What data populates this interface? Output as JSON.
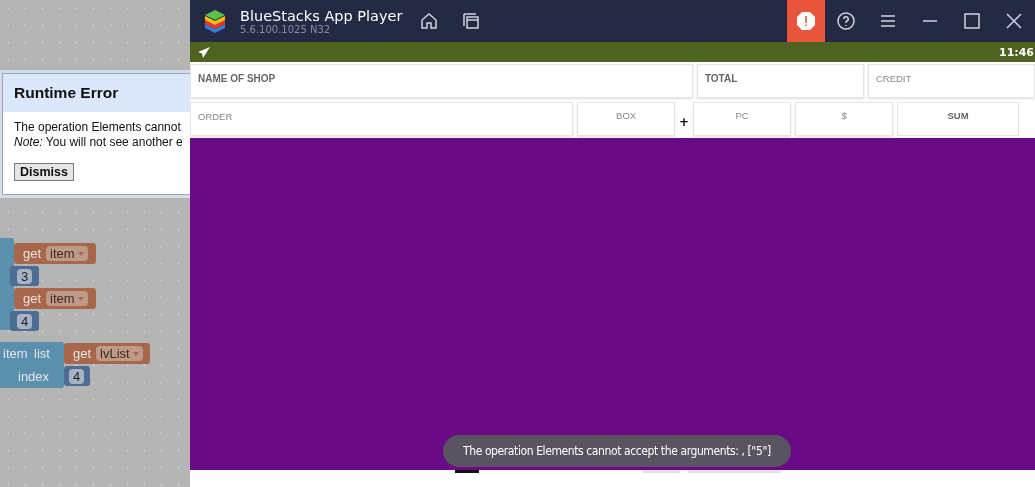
{
  "workspace": {
    "get_blocks": [
      {
        "keyword": "get",
        "variable": "item",
        "argument": "3"
      },
      {
        "keyword": "get",
        "variable": "item",
        "argument": "4"
      }
    ],
    "select_block": {
      "item_label": "item",
      "list_label": "list",
      "index_label": "index",
      "get": {
        "keyword": "get",
        "variable": "lvList"
      },
      "index_value": "4"
    },
    "dialog": {
      "title": "Runtime Error",
      "message": "The operation Elements cannot",
      "note": "*Note:* You will not see another e",
      "button": "Dismiss"
    }
  },
  "emulator": {
    "title": "BlueStacks App Player",
    "version": "5.6.100.1025  N32",
    "status_time": "11:46",
    "form_rows": [
      [
        {
          "kind": "label",
          "text": "NAME OF SHOP"
        },
        {
          "kind": "label",
          "text": "TOTAL"
        },
        {
          "kind": "input",
          "placeholder": "CREDIT"
        }
      ],
      [
        {
          "kind": "input",
          "placeholder": "ORDER"
        },
        {
          "kind": "input",
          "placeholder": "BOX"
        },
        {
          "kind": "sign",
          "text": "+"
        },
        {
          "kind": "input",
          "placeholder": "PC"
        },
        {
          "kind": "input",
          "placeholder": "$"
        },
        {
          "kind": "button",
          "text": "SUM"
        }
      ]
    ],
    "toast": "The operation Elements cannot accept the arguments: , [\"5\"]"
  }
}
